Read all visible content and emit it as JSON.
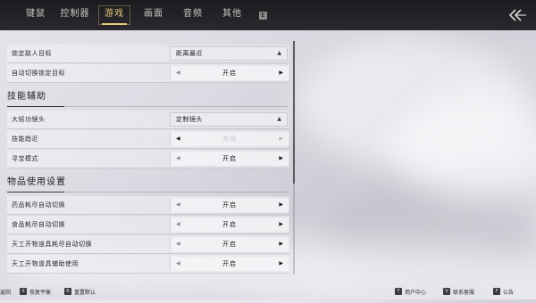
{
  "tabs": [
    {
      "label": "键鼠",
      "active": false
    },
    {
      "label": "控制器",
      "active": false
    },
    {
      "label": "游戏",
      "active": true
    },
    {
      "label": "画面",
      "active": false
    },
    {
      "label": "音频",
      "active": false
    },
    {
      "label": "其他",
      "active": false
    }
  ],
  "tab_key_hint": "E",
  "settings": {
    "row1": {
      "label": "锁定敌人目标",
      "value": "距离最近"
    },
    "row2": {
      "label": "自动切换锁定目标",
      "value": "开启"
    },
    "section_skill": "技能辅助",
    "row3": {
      "label": "大轻功镜头",
      "value": "定制镜头"
    },
    "row4": {
      "label": "技能趋近",
      "value": "关闭"
    },
    "row5": {
      "label": "寻宝模式",
      "value": "开启"
    },
    "section_item": "物品使用设置",
    "row6": {
      "label": "药品耗尽自动切换",
      "value": "开启"
    },
    "row7": {
      "label": "食品耗尽自动切换",
      "value": "开启"
    },
    "row8": {
      "label": "天工开物道具耗尽自动切换",
      "value": "开启"
    },
    "row9": {
      "label": "天工开物道具辅助使用",
      "value": "开启"
    }
  },
  "bottom": {
    "back_label": "返回",
    "x_key": "X",
    "x_label": "恢复平衡",
    "r_key": "R",
    "r_label": "重置默认",
    "t_key": "T",
    "t_label": "用户中心",
    "v_key": "V",
    "v_label": "联系客服",
    "f_key": "F",
    "f_label": "公告"
  },
  "colors": {
    "accent": "#e9c878",
    "topbar": "#1c1b1f"
  }
}
